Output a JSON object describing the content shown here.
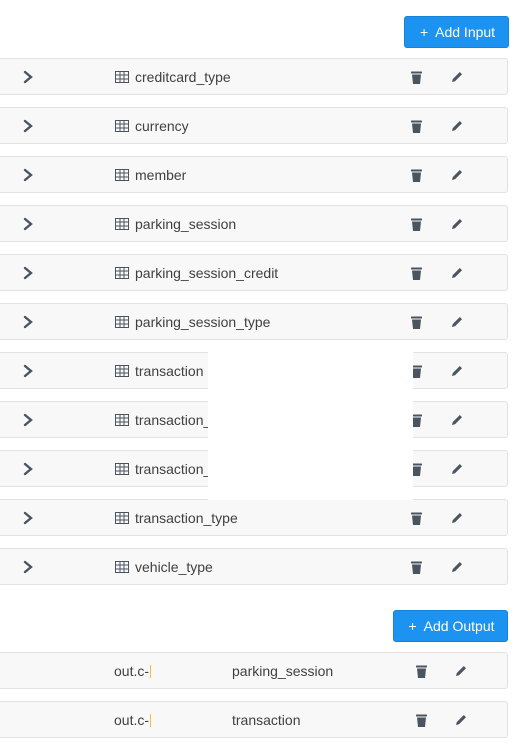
{
  "inputs": {
    "add_label": "Add Input",
    "items": [
      {
        "label": "creditcard_type"
      },
      {
        "label": "currency"
      },
      {
        "label": "member"
      },
      {
        "label": "parking_session"
      },
      {
        "label": "parking_session_credit"
      },
      {
        "label": "parking_session_type"
      },
      {
        "label": "transaction"
      },
      {
        "label": "transaction_"
      },
      {
        "label": "transaction_"
      },
      {
        "label": "transaction_type"
      },
      {
        "label": "vehicle_type"
      }
    ]
  },
  "outputs": {
    "add_label": "Add Output",
    "items": [
      {
        "source": "out.c-",
        "destination": "parking_session"
      },
      {
        "source": "out.c-",
        "destination": "transaction"
      }
    ]
  },
  "colors": {
    "primary": "#1c93f0",
    "row_bg": "#f8f8f8",
    "row_border": "#e2e2e2",
    "icon": "#4a5560"
  }
}
